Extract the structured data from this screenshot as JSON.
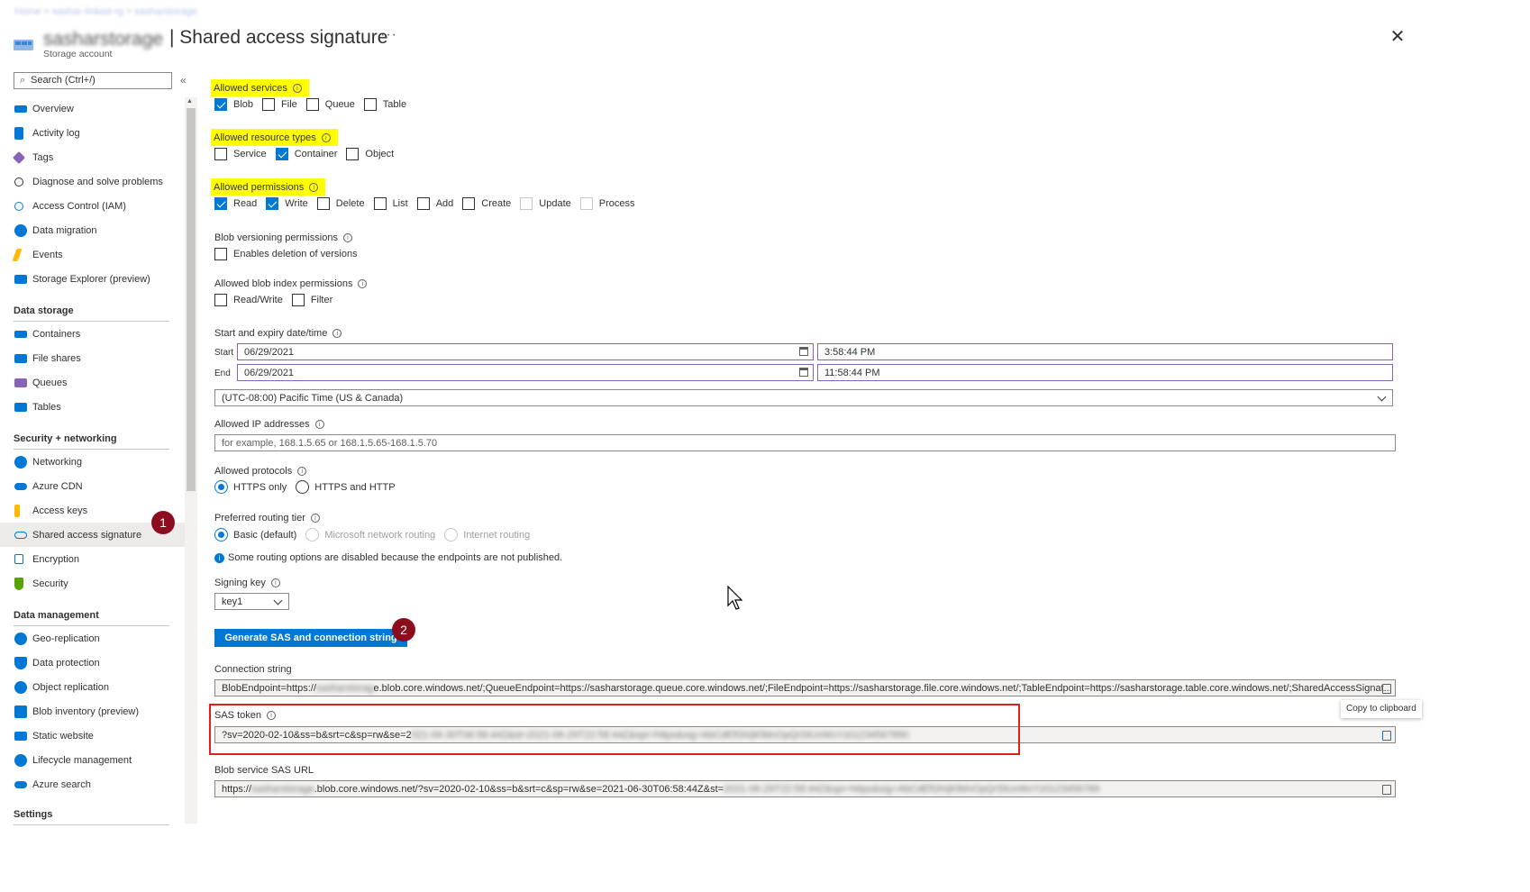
{
  "header": {
    "breadcrumb": "Home > sashar-linked-rg > sasharstorage",
    "resource_name": "sasharstorage",
    "title": "| Shared access signature",
    "subtitle": "Storage account",
    "more": "···",
    "close": "✕"
  },
  "sidebar": {
    "search_placeholder": "Search (Ctrl+/)",
    "collapse": "«",
    "items": [
      {
        "label": "Overview",
        "icon": "overview-icon",
        "color": "#0078d4"
      },
      {
        "label": "Activity log",
        "icon": "activity-log-icon",
        "color": "#0078d4"
      },
      {
        "label": "Tags",
        "icon": "tag-icon",
        "color": "#8764b8"
      },
      {
        "label": "Diagnose and solve problems",
        "icon": "wrench-icon",
        "color": "#323130"
      },
      {
        "label": "Access Control (IAM)",
        "icon": "people-icon",
        "color": "#0078d4"
      },
      {
        "label": "Data migration",
        "icon": "migration-icon",
        "color": "#0078d4"
      },
      {
        "label": "Events",
        "icon": "lightning-icon",
        "color": "#ffb900"
      },
      {
        "label": "Storage Explorer (preview)",
        "icon": "explorer-icon",
        "color": "#0078d4"
      }
    ],
    "sections": {
      "data_storage": {
        "title": "Data storage",
        "items": [
          {
            "label": "Containers",
            "icon": "containers-icon",
            "color": "#0078d4"
          },
          {
            "label": "File shares",
            "icon": "file-shares-icon",
            "color": "#0078d4"
          },
          {
            "label": "Queues",
            "icon": "queues-icon",
            "color": "#8764b8"
          },
          {
            "label": "Tables",
            "icon": "tables-icon",
            "color": "#0078d4"
          }
        ]
      },
      "security_networking": {
        "title": "Security + networking",
        "items": [
          {
            "label": "Networking",
            "icon": "networking-icon",
            "color": "#0078d4"
          },
          {
            "label": "Azure CDN",
            "icon": "cloud-icon",
            "color": "#0078d4"
          },
          {
            "label": "Access keys",
            "icon": "key-icon",
            "color": "#ffb900"
          },
          {
            "label": "Shared access signature",
            "icon": "link-icon",
            "color": "#0078d4"
          },
          {
            "label": "Encryption",
            "icon": "lock-icon",
            "color": "#0078d4"
          },
          {
            "label": "Security",
            "icon": "shield-icon",
            "color": "#57a300"
          }
        ]
      },
      "data_management": {
        "title": "Data management",
        "items": [
          {
            "label": "Geo-replication",
            "icon": "globe-icon",
            "color": "#0078d4"
          },
          {
            "label": "Data protection",
            "icon": "protection-icon",
            "color": "#0078d4"
          },
          {
            "label": "Object replication",
            "icon": "replication-icon",
            "color": "#0078d4"
          },
          {
            "label": "Blob inventory (preview)",
            "icon": "inventory-icon",
            "color": "#0078d4"
          },
          {
            "label": "Static website",
            "icon": "website-icon",
            "color": "#0078d4"
          },
          {
            "label": "Lifecycle management",
            "icon": "lifecycle-icon",
            "color": "#0078d4"
          },
          {
            "label": "Azure search",
            "icon": "search-cloud-icon",
            "color": "#0078d4"
          }
        ]
      },
      "settings": {
        "title": "Settings"
      }
    }
  },
  "markers": {
    "one": "1",
    "two": "2"
  },
  "form": {
    "services": {
      "title": "Allowed services",
      "options": [
        {
          "label": "Blob",
          "checked": true
        },
        {
          "label": "File",
          "checked": false
        },
        {
          "label": "Queue",
          "checked": false
        },
        {
          "label": "Table",
          "checked": false
        }
      ]
    },
    "resource_types": {
      "title": "Allowed resource types",
      "options": [
        {
          "label": "Service",
          "checked": false
        },
        {
          "label": "Container",
          "checked": true
        },
        {
          "label": "Object",
          "checked": false
        }
      ]
    },
    "permissions": {
      "title": "Allowed permissions",
      "options": [
        {
          "label": "Read",
          "checked": true
        },
        {
          "label": "Write",
          "checked": true
        },
        {
          "label": "Delete",
          "checked": false
        },
        {
          "label": "List",
          "checked": false
        },
        {
          "label": "Add",
          "checked": false
        },
        {
          "label": "Create",
          "checked": false
        },
        {
          "label": "Update",
          "checked": false
        },
        {
          "label": "Process",
          "checked": false
        }
      ]
    },
    "versioning": {
      "title": "Blob versioning permissions",
      "option": "Enables deletion of versions"
    },
    "index": {
      "title": "Allowed blob index permissions",
      "options": [
        "Read/Write",
        "Filter"
      ]
    },
    "datetime": {
      "title": "Start and expiry date/time",
      "start_label": "Start",
      "start_date": "06/29/2021",
      "start_time": "3:58:44 PM",
      "end_label": "End",
      "end_date": "06/29/2021",
      "end_time": "11:58:44 PM",
      "timezone": "(UTC-08:00) Pacific Time (US & Canada)"
    },
    "ip": {
      "title": "Allowed IP addresses",
      "placeholder": "for example, 168.1.5.65 or 168.1.5.65-168.1.5.70"
    },
    "protocols": {
      "title": "Allowed protocols",
      "options": [
        "HTTPS only",
        "HTTPS and HTTP"
      ]
    },
    "routing": {
      "title": "Preferred routing tier",
      "options": [
        "Basic (default)",
        "Microsoft network routing",
        "Internet routing"
      ],
      "note": "Some routing options are disabled because the endpoints are not published."
    },
    "signing": {
      "title": "Signing key",
      "value": "key1"
    },
    "generate": "Generate SAS and connection string",
    "connection": {
      "title": "Connection string",
      "prefix": "BlobEndpoint=https://",
      "hidden": "sasharstorag",
      "rest": "e.blob.core.windows.net/;QueueEndpoint=https://sasharstorage.queue.core.windows.net/;FileEndpoint=https://sasharstorage.file.core.windows.net/;TableEndpoint=https://sasharstorage.table.core.windows.net/;SharedAccessSignat..."
    },
    "sas": {
      "title": "SAS token",
      "visible": "?sv=2020-02-10&ss=b&srt=c&sp=rw&se=2",
      "hidden": "021-06-30T06:58:44Z&st=2021-06-29T22:58:44Z&spr=https&sig=AbCdEfGhIjKlMnOpQrStUvWxYz01234567890"
    },
    "blob_url": {
      "title": "Blob service SAS URL",
      "prefix": "https://",
      "hidden_a": "sasharstorage",
      "visible": ".blob.core.windows.net/?sv=2020-02-10&ss=b&srt=c&sp=rw&se=2021-06-30T06:58:44Z&st=",
      "hidden_b": "2021-06-29T22:58:44Z&spr=https&sig=AbCdEfGhIjKlMnOpQrStUvWxYz0123456789"
    },
    "tooltip": "Copy to clipboard"
  }
}
